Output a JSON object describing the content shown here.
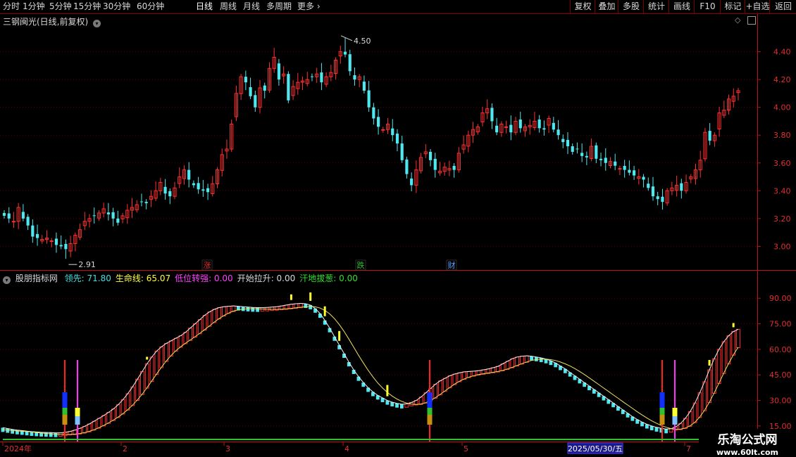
{
  "toolbar": {
    "periods": [
      "分时",
      "1分钟",
      "5分钟",
      "15分钟",
      "30分钟",
      "60分钟",
      "日线",
      "周线",
      "月线",
      "多周期",
      "更多"
    ],
    "active_period": "日线",
    "right_buttons": [
      "复权",
      "叠加",
      "多股",
      "统计",
      "画线",
      "F10",
      "标记",
      "+自选",
      "返回"
    ]
  },
  "main_panel": {
    "title": "三钢闽光(日线,前复权)",
    "high_label": "4.50",
    "low_label": "2.91",
    "event_markers": [
      {
        "label": "涨",
        "color": "#e03030"
      },
      {
        "label": "跌",
        "color": "#30c030"
      },
      {
        "label": "财",
        "color": "#60a0ff"
      }
    ]
  },
  "indicator_panel": {
    "name": "股朋指标网",
    "values": [
      {
        "label": "领先",
        "value": "71.80",
        "color": "#40e0e0"
      },
      {
        "label": "生命线",
        "value": "65.07",
        "color": "#ffff40"
      },
      {
        "label": "低位转强",
        "value": "0.00",
        "color": "#ff40ff"
      },
      {
        "label": "开始拉升",
        "value": "0.00",
        "color": "#d8d8d8"
      },
      {
        "label": "汗地拔葱",
        "value": "0.00",
        "color": "#30e030"
      }
    ]
  },
  "date_axis": {
    "labels": [
      "2024年",
      "2",
      "3",
      "4",
      "5",
      "7"
    ],
    "cursor_date": "2025/05/30/五"
  },
  "watermark": {
    "title": "乐淘公式网",
    "url": "www.60lt.com"
  },
  "colors": {
    "up": "#ff3030",
    "down": "#50e8f0",
    "grid": "#5a0000",
    "axis": "#c01010",
    "ma_line": "#f0f0f0",
    "life_line": "#f0e060",
    "signal_red": "#ff2020",
    "signal_magenta": "#ff30ff",
    "baseline": "#30c030"
  },
  "chart_data": [
    {
      "type": "candlestick",
      "title": "三钢闽光(日线,前复权)",
      "y_ticks": [
        "4.40",
        "4.20",
        "4.00",
        "3.80",
        "3.60",
        "3.40",
        "3.20",
        "3.00"
      ],
      "ylim": [
        2.83,
        4.58
      ],
      "high": 4.5,
      "low": 2.91,
      "close_series": [
        3.22,
        3.2,
        3.18,
        3.28,
        3.2,
        3.15,
        3.07,
        3.06,
        3.05,
        3.06,
        3.04,
        3.01,
        3.0,
        2.98,
        3.02,
        3.08,
        3.12,
        3.18,
        3.2,
        3.22,
        3.24,
        3.27,
        3.23,
        3.2,
        3.17,
        3.22,
        3.26,
        3.28,
        3.3,
        3.32,
        3.31,
        3.36,
        3.4,
        3.46,
        3.38,
        3.36,
        3.42,
        3.5,
        3.55,
        3.48,
        3.44,
        3.41,
        3.4,
        3.39,
        3.45,
        3.55,
        3.66,
        3.7,
        3.88,
        4.1,
        4.22,
        4.18,
        4.08,
        4.0,
        4.14,
        4.12,
        4.28,
        4.36,
        4.2,
        4.24,
        4.05,
        4.15,
        4.18,
        4.19,
        4.2,
        4.22,
        4.24,
        4.18,
        4.22,
        4.25,
        4.34,
        4.4,
        4.38,
        4.26,
        4.2,
        4.22,
        4.12,
        4.0,
        3.92,
        3.86,
        3.84,
        3.88,
        3.8,
        3.74,
        3.62,
        3.52,
        3.44,
        3.55,
        3.64,
        3.68,
        3.62,
        3.55,
        3.54,
        3.57,
        3.56,
        3.55,
        3.67,
        3.73,
        3.8,
        3.84,
        3.86,
        3.96,
        3.99,
        3.9,
        3.82,
        3.88,
        3.86,
        3.82,
        3.9,
        3.85,
        3.86,
        3.87,
        3.9,
        3.85,
        3.84,
        3.92,
        3.84,
        3.8,
        3.75,
        3.72,
        3.68,
        3.7,
        3.65,
        3.64,
        3.72,
        3.63,
        3.62,
        3.6,
        3.61,
        3.58,
        3.56,
        3.55,
        3.53,
        3.51,
        3.5,
        3.48,
        3.42,
        3.36,
        3.34,
        3.32,
        3.4,
        3.42,
        3.44,
        3.4,
        3.46,
        3.5,
        3.55,
        3.62,
        3.82,
        3.76,
        3.8,
        3.96,
        3.98,
        4.06,
        4.08,
        4.12
      ],
      "x_labels": [
        "2024年",
        "2",
        "3",
        "4",
        "5",
        "7"
      ]
    },
    {
      "type": "bar",
      "title": "股朋指标网",
      "y_ticks": [
        "90.00",
        "75.00",
        "60.00",
        "45.00",
        "30.00",
        "15.00"
      ],
      "ylim": [
        10,
        100
      ],
      "series": [
        {
          "name": "领先",
          "value": 71.8
        },
        {
          "name": "生命线",
          "value": 65.07
        },
        {
          "name": "低位转强",
          "value": 0.0
        },
        {
          "name": "开始拉升",
          "value": 0.0
        },
        {
          "name": "汗地拔葱",
          "value": 0.0
        }
      ],
      "lead_series": [
        14.0,
        13.5,
        13.0,
        12.6,
        12.3,
        12.0,
        11.7,
        11.5,
        11.3,
        11.2,
        11.1,
        11.0,
        11.0,
        11.3,
        11.8,
        12.6,
        13.6,
        14.8,
        16.2,
        17.8,
        19.5,
        21.2,
        23.0,
        25.0,
        27.5,
        30.5,
        34.0,
        38.0,
        42.5,
        47.0,
        51.5,
        55.5,
        59.0,
        61.5,
        63.5,
        65.0,
        66.5,
        68.0,
        70.0,
        72.5,
        75.0,
        77.5,
        80.0,
        82.0,
        83.5,
        84.5,
        85.0,
        85.3,
        85.5,
        85.3,
        85.0,
        84.8,
        84.6,
        84.5,
        84.5,
        84.6,
        84.8,
        85.0,
        85.5,
        86.0,
        86.5,
        86.8,
        87.0,
        86.8,
        86.0,
        84.0,
        81.0,
        77.0,
        72.5,
        67.5,
        62.5,
        57.5,
        52.5,
        48.0,
        44.0,
        40.5,
        37.5,
        35.0,
        33.0,
        31.5,
        30.0,
        29.0,
        28.3,
        27.8,
        28.0,
        28.8,
        30.0,
        32.0,
        34.5,
        37.0,
        39.5,
        41.5,
        43.0,
        44.5,
        45.5,
        46.2,
        46.8,
        47.0,
        47.2,
        47.5,
        48.0,
        48.5,
        49.2,
        50.0,
        51.5,
        53.0,
        54.5,
        55.5,
        56.0,
        56.2,
        56.0,
        55.5,
        55.0,
        54.3,
        53.3,
        52.0,
        50.3,
        48.5,
        46.5,
        44.5,
        42.5,
        40.5,
        38.5,
        36.5,
        34.5,
        32.5,
        30.5,
        28.5,
        26.5,
        24.5,
        22.5,
        20.5,
        18.8,
        17.3,
        16.0,
        15.0,
        14.2,
        13.6,
        13.2,
        13.4,
        14.5,
        16.5,
        19.5,
        23.5,
        28.5,
        34.5,
        41.0,
        48.0,
        54.5,
        60.0,
        64.5,
        68.0,
        70.5,
        71.8
      ]
    }
  ]
}
